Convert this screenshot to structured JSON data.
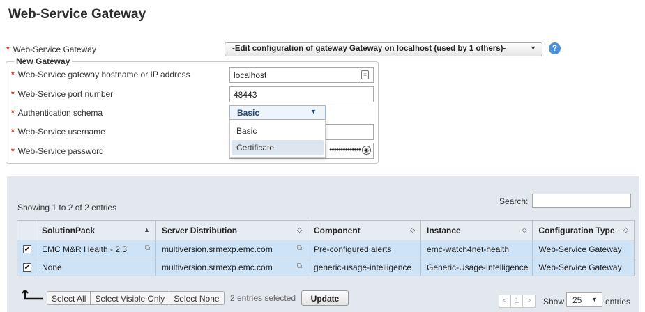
{
  "page_title": "Web-Service Gateway",
  "gateway": {
    "label": "Web-Service Gateway",
    "selected": "-Edit configuration of gateway Gateway on localhost (used by 1 others)-",
    "help": "?"
  },
  "new_gateway": {
    "legend": "New Gateway",
    "hostname_label": "Web-Service gateway hostname or IP address",
    "hostname_value": "localhost",
    "port_label": "Web-Service port number",
    "port_value": "48443",
    "auth_label": "Authentication schema",
    "auth_value": "Basic",
    "auth_options": [
      "Basic",
      "Certificate"
    ],
    "username_label": "Web-Service username",
    "password_label": "Web-Service password",
    "password_mask": "••••••••••••••"
  },
  "table": {
    "info": "Showing 1 to 2 of 2 entries",
    "search_label": "Search:",
    "columns": [
      "SolutionPack",
      "Server Distribution",
      "Component",
      "Instance",
      "Configuration Type"
    ],
    "rows": [
      {
        "checked": "✔",
        "solutionpack": "EMC M&R Health - 2.3",
        "server": "multiversion.srmexp.emc.com",
        "component": "Pre-configured alerts",
        "instance": "emc-watch4net-health",
        "type": "Web-Service Gateway"
      },
      {
        "checked": "✔",
        "solutionpack": "None",
        "server": "multiversion.srmexp.emc.com",
        "component": "generic-usage-intelligence",
        "instance": "Generic-Usage-Intelligence",
        "type": "Web-Service Gateway"
      }
    ]
  },
  "footer": {
    "select_all": "Select All",
    "select_visible": "Select Visible Only",
    "select_none": "Select None",
    "selected_count": "2 entries selected",
    "update": "Update",
    "pager_prev": "<",
    "pager_page": "1",
    "pager_next": ">",
    "show": "Show",
    "page_size": "25",
    "entries": "entries"
  }
}
